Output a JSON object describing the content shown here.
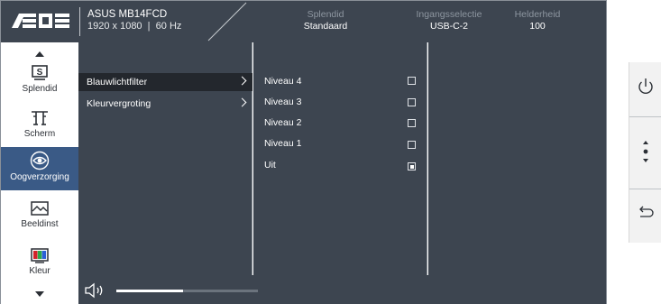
{
  "header": {
    "brand": "ASUS",
    "model": "ASUS MB14FCD",
    "resolution": "1920 x 1080",
    "refresh": "60 Hz",
    "columns": [
      {
        "label": "Splendid",
        "value": "Standaard"
      },
      {
        "label": "Ingangsselectie",
        "value": "USB-C-2"
      },
      {
        "label": "Helderheid",
        "value": "100"
      }
    ]
  },
  "sidebar": {
    "items": [
      {
        "label": "Splendid",
        "icon": "splendid-icon"
      },
      {
        "label": "Scherm",
        "icon": "scherm-icon"
      },
      {
        "label": "Oogverzorging",
        "icon": "eye-icon",
        "active": true
      },
      {
        "label": "Beeldinst",
        "icon": "picture-icon"
      },
      {
        "label": "Kleur",
        "icon": "color-icon"
      }
    ]
  },
  "submenu": {
    "items": [
      {
        "label": "Blauwlichtfilter",
        "selected": true
      },
      {
        "label": "Kleurvergroting",
        "selected": false
      }
    ]
  },
  "options": {
    "items": [
      {
        "label": "Niveau 4",
        "checked": false
      },
      {
        "label": "Niveau 3",
        "checked": false
      },
      {
        "label": "Niveau 2",
        "checked": false
      },
      {
        "label": "Niveau 1",
        "checked": false
      },
      {
        "label": "Uit",
        "checked": true
      }
    ]
  },
  "footer": {
    "volume_fraction": 0.47,
    "icon": "speaker-icon"
  },
  "keys": [
    {
      "icon": "power-icon"
    },
    {
      "icon": "menu-joystick-icon"
    },
    {
      "icon": "back-icon"
    }
  ],
  "colors": {
    "panel": "#3d4550",
    "active": "#3a5a86",
    "selected_row": "#23272d"
  }
}
